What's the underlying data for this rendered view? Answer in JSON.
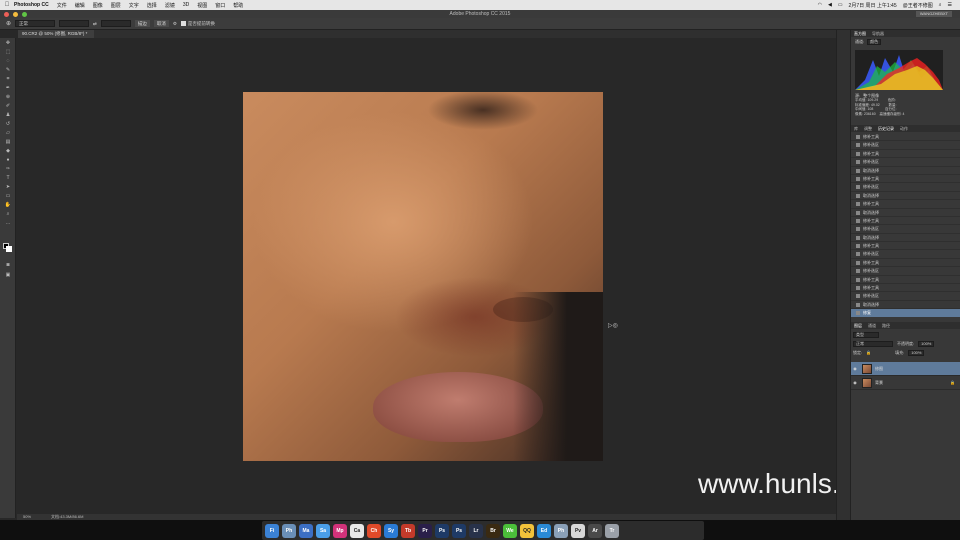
{
  "menubar": {
    "app_name": "Photoshop CC",
    "items": [
      "文件",
      "编辑",
      "图像",
      "图层",
      "文字",
      "选择",
      "滤镜",
      "3D",
      "视图",
      "窗口",
      "帮助"
    ],
    "clock": "2月7日 周日 上午1:45",
    "user": "@王者不修图"
  },
  "window": {
    "title": "Adobe Photoshop CC 2015",
    "profile_button": "WANGZHEBXT"
  },
  "options_bar": {
    "mode_label": "正常",
    "mode_value": "",
    "button_a": "描边",
    "button_b": "取消",
    "checkbox_label": "是否提前转换"
  },
  "document": {
    "tab_label": "90.CR2 @ 50% (修图, RGB/8*) *",
    "status_zoom": "50%",
    "status_doc": "文档:43.3M/86.6M"
  },
  "watermark": "www.hunls.com",
  "cursor_label": "▷◎",
  "panels": {
    "top_tabs": [
      "直方图",
      "导航器"
    ],
    "channel_label": "通道:",
    "channel_value": "颜色",
    "source_label": "源:",
    "source_value": "整个图像",
    "stats": {
      "mean_label": "平均值:",
      "mean": "109.29",
      "std_label": "标准偏差:",
      "std": "49.02",
      "median_label": "中间值:",
      "median": "108",
      "pixels_label": "像素:",
      "pixels": "236160",
      "level_label": "色阶:",
      "count_label": "数量:",
      "percent_label": "百分位:",
      "cache_label": "高速缓存级别:",
      "cache": "4"
    },
    "history_tabs": [
      "库",
      "调整",
      "历史记录",
      "动作"
    ],
    "history_items": [
      "修补工具",
      "修补选区",
      "修补工具",
      "修补选区",
      "取消选择",
      "修补工具",
      "修补选区",
      "取消选择",
      "修补工具",
      "取消选择",
      "修补工具",
      "修补选区",
      "取消选择",
      "修补工具",
      "修补选区",
      "修补工具",
      "修补选区",
      "修补工具",
      "修补工具",
      "修补选区",
      "取消选择",
      "修复"
    ],
    "layers_tabs": [
      "图层",
      "通道",
      "路径"
    ],
    "kind_label": "类型",
    "blend_mode": "正常",
    "opacity_label": "不透明度:",
    "opacity": "100%",
    "lock_label": "锁定:",
    "fill_label": "填充:",
    "fill": "100%",
    "layers": [
      {
        "name": "修图",
        "active": true
      },
      {
        "name": "背景",
        "active": false
      }
    ]
  },
  "dock": {
    "apps": [
      {
        "label": "Fi",
        "color": "#3b82d6"
      },
      {
        "label": "Ph",
        "color": "#6a8fb8"
      },
      {
        "label": "Ma",
        "color": "#3c6fc4"
      },
      {
        "label": "Sa",
        "color": "#4a9ee8"
      },
      {
        "label": "Mp",
        "color": "#d2327a"
      },
      {
        "label": "Ca",
        "color": "#e8e8e8"
      },
      {
        "label": "Ch",
        "color": "#e04a2a"
      },
      {
        "label": "Sy",
        "color": "#2a7bd6"
      },
      {
        "label": "Tb",
        "color": "#c43a2a"
      },
      {
        "label": "Pr",
        "color": "#2a1f4a"
      },
      {
        "label": "Ps",
        "color": "#1e3a66"
      },
      {
        "label": "Ps",
        "color": "#1e3a66"
      },
      {
        "label": "Lr",
        "color": "#28324a"
      },
      {
        "label": "Br",
        "color": "#3a2a12"
      },
      {
        "label": "We",
        "color": "#4bbf3a"
      },
      {
        "label": "QQ",
        "color": "#f2c23a"
      },
      {
        "label": "Ed",
        "color": "#2a8ad6"
      },
      {
        "label": "Ph",
        "color": "#8aa0b8"
      },
      {
        "label": "Pv",
        "color": "#d8d8d8"
      },
      {
        "label": "Ar",
        "color": "#4a4a4a"
      },
      {
        "label": "Tr",
        "color": "#9aa0a8"
      }
    ]
  }
}
